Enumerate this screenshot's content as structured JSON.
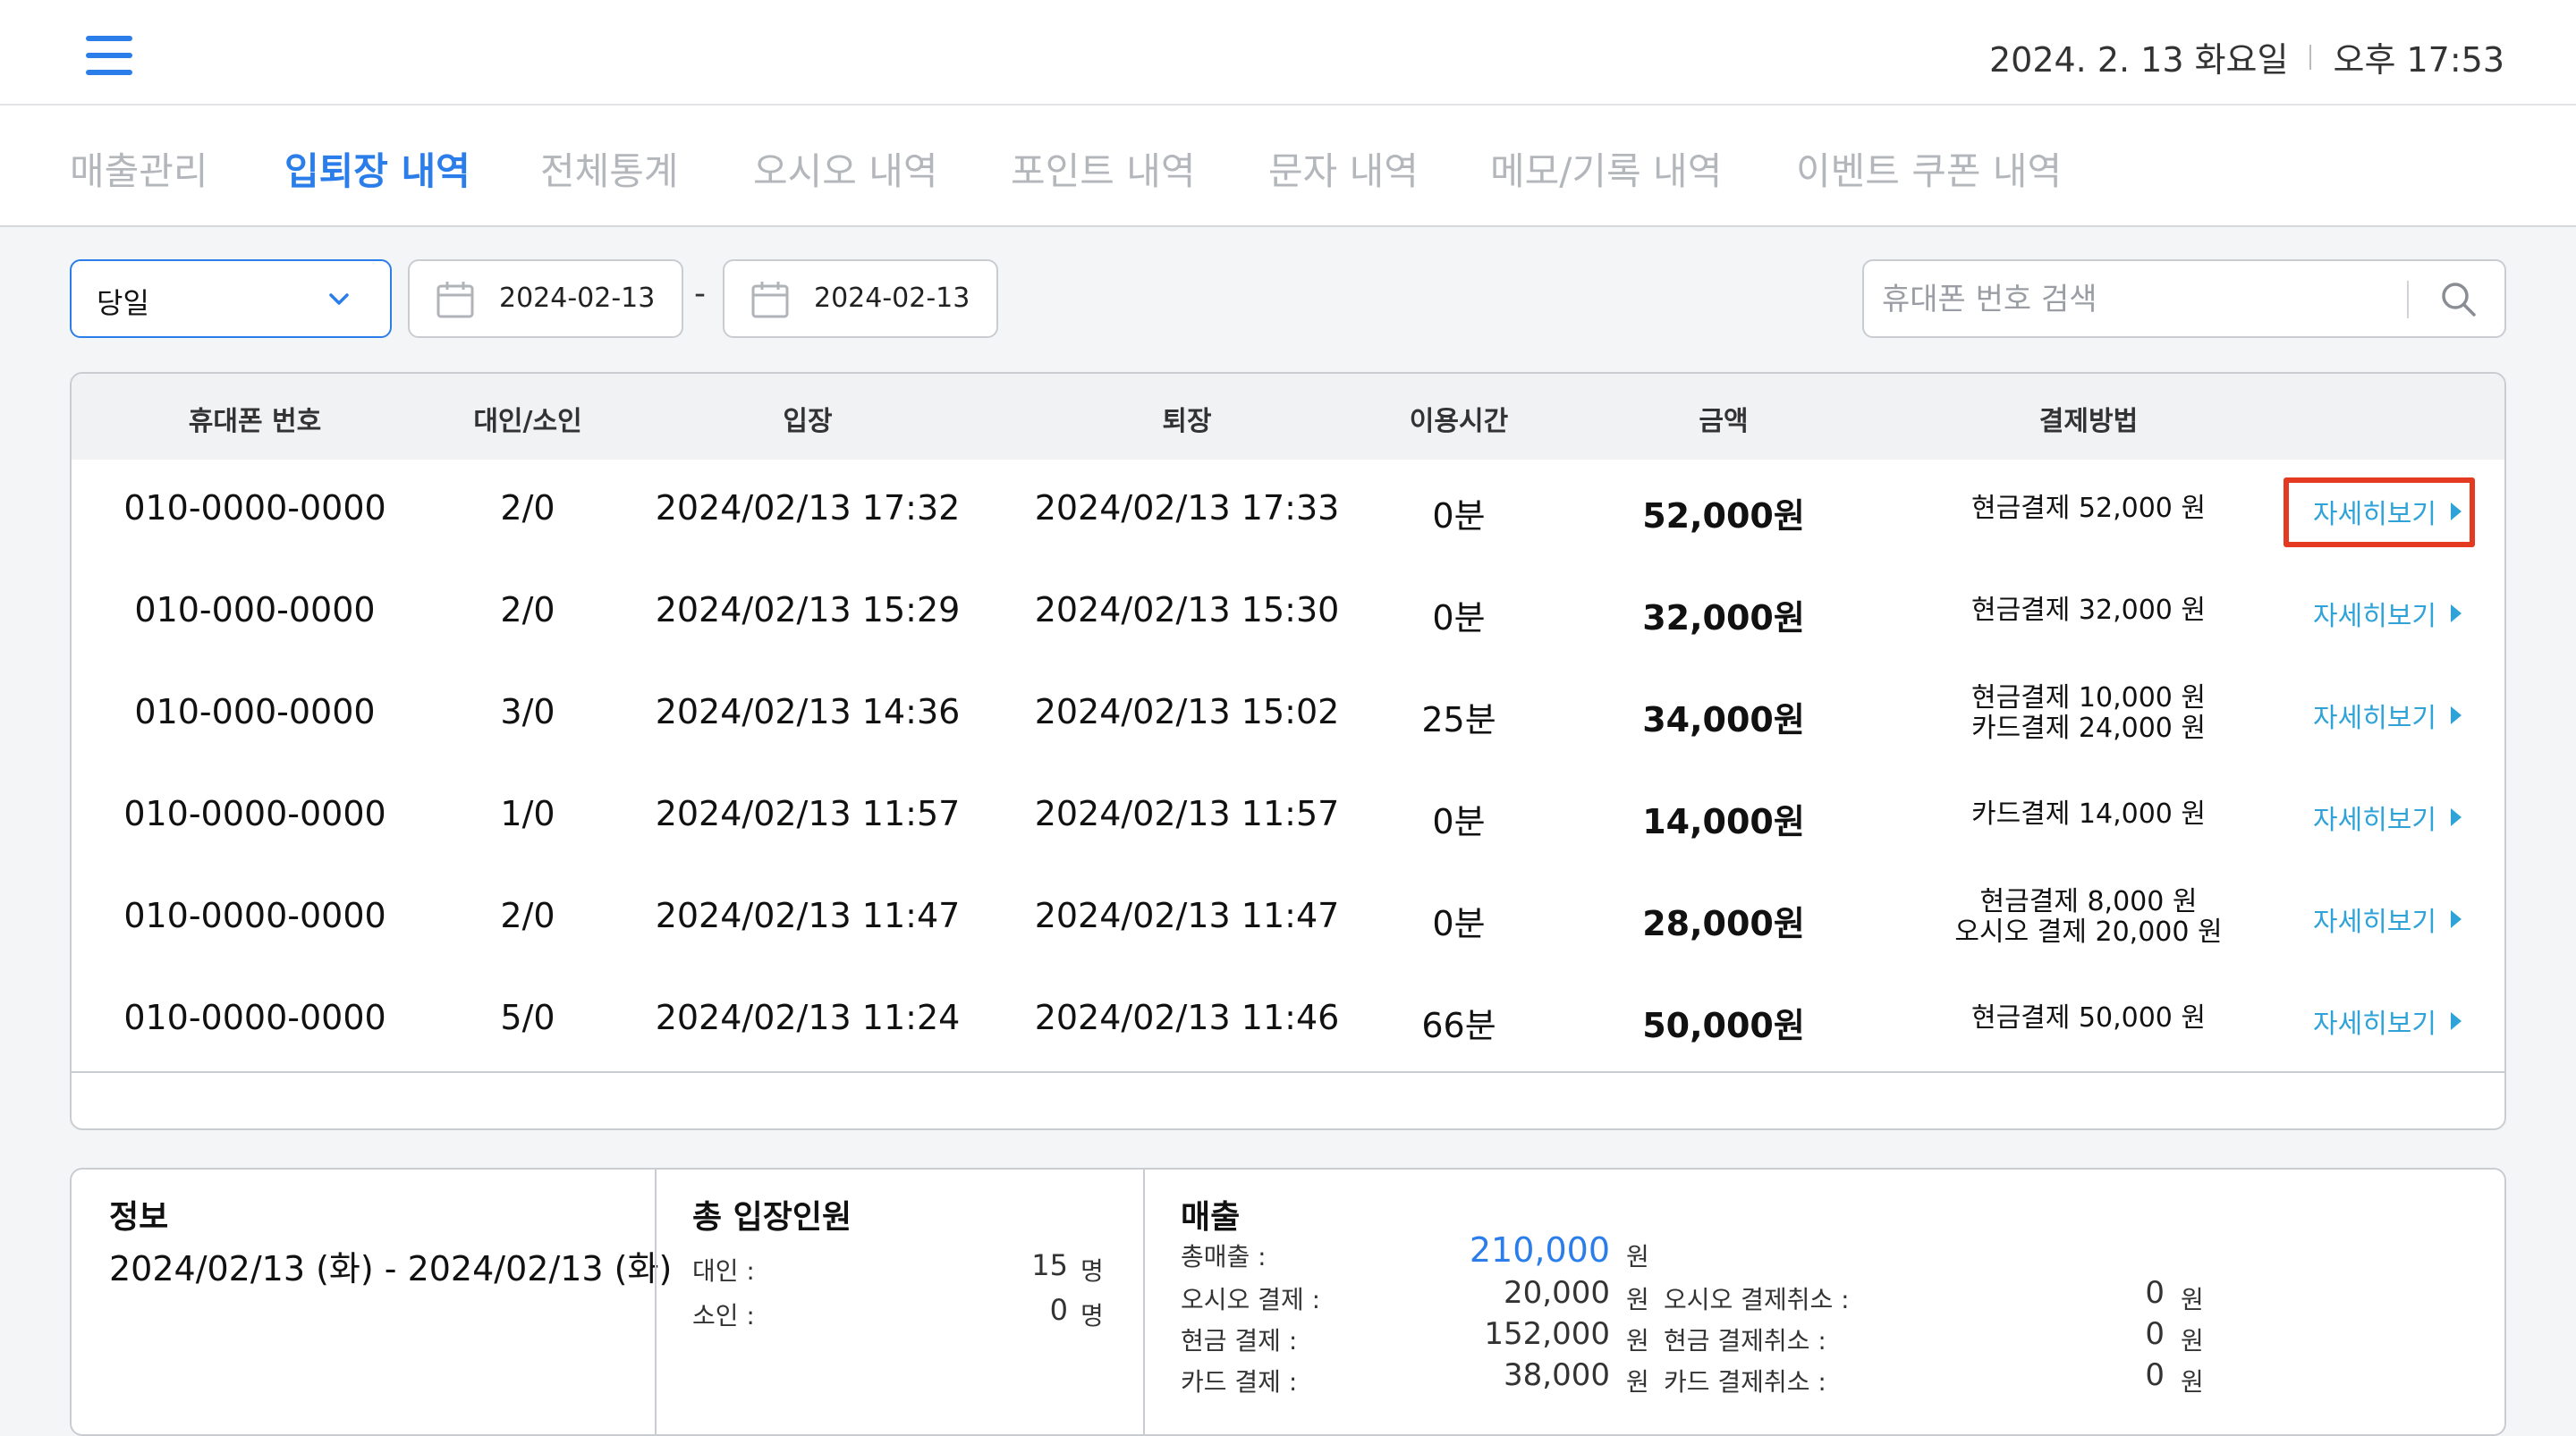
{
  "header": {
    "date": "2024. 2. 13 화요일",
    "time": "오후 17:53"
  },
  "tabs": [
    {
      "label": "매출관리",
      "active": false
    },
    {
      "label": "입퇴장 내역",
      "active": true
    },
    {
      "label": "전체통계",
      "active": false
    },
    {
      "label": "오시오 내역",
      "active": false
    },
    {
      "label": "포인트 내역",
      "active": false
    },
    {
      "label": "문자 내역",
      "active": false
    },
    {
      "label": "메모/기록 내역",
      "active": false
    },
    {
      "label": "이벤트 쿠폰 내역",
      "active": false
    }
  ],
  "filters": {
    "period": "당일",
    "start_date": "2024-02-13",
    "date_separator": "-",
    "end_date": "2024-02-13",
    "search_placeholder": "휴대폰 번호 검색"
  },
  "table": {
    "columns": [
      "휴대폰 번호",
      "대인/소인",
      "입장",
      "퇴장",
      "이용시간",
      "금액",
      "결제방법"
    ],
    "detail_label": "자세히보기",
    "rows": [
      {
        "phone": "010-0000-0000",
        "people": "2/0",
        "entry": "2024/02/13 17:32",
        "exit": "2024/02/13 17:33",
        "duration": "0분",
        "amount": "52,000원",
        "payment": [
          "현금결제 52,000 원"
        ]
      },
      {
        "phone": "010-000-0000",
        "people": "2/0",
        "entry": "2024/02/13 15:29",
        "exit": "2024/02/13 15:30",
        "duration": "0분",
        "amount": "32,000원",
        "payment": [
          "현금결제 32,000 원"
        ]
      },
      {
        "phone": "010-000-0000",
        "people": "3/0",
        "entry": "2024/02/13 14:36",
        "exit": "2024/02/13 15:02",
        "duration": "25분",
        "amount": "34,000원",
        "payment": [
          "현금결제 10,000 원",
          "카드결제 24,000 원"
        ]
      },
      {
        "phone": "010-0000-0000",
        "people": "1/0",
        "entry": "2024/02/13 11:57",
        "exit": "2024/02/13 11:57",
        "duration": "0분",
        "amount": "14,000원",
        "payment": [
          "카드결제 14,000 원"
        ]
      },
      {
        "phone": "010-0000-0000",
        "people": "2/0",
        "entry": "2024/02/13 11:47",
        "exit": "2024/02/13 11:47",
        "duration": "0분",
        "amount": "28,000원",
        "payment": [
          "현금결제 8,000 원",
          "오시오 결제 20,000 원"
        ]
      },
      {
        "phone": "010-0000-0000",
        "people": "5/0",
        "entry": "2024/02/13 11:24",
        "exit": "2024/02/13 11:46",
        "duration": "66분",
        "amount": "50,000원",
        "payment": [
          "현금결제 50,000 원"
        ]
      }
    ]
  },
  "summary": {
    "info_title": "정보",
    "info_range": "2024/02/13 (화)  -  2024/02/13 (화)",
    "visitors_title": "총 입장인원",
    "adult_label": "대인 :",
    "adult_count": "15",
    "child_label": "소인 :",
    "child_count": "0",
    "person_unit": "명",
    "sales_title": "매출",
    "won_unit": "원",
    "total_label": "총매출 :",
    "total_value": "210,000",
    "osio_label": "오시오 결제 :",
    "osio_value": "20,000",
    "osio_cancel_label": "오시오 결제취소 :",
    "osio_cancel_value": "0",
    "cash_label": "현금 결제 :",
    "cash_value": "152,000",
    "cash_cancel_label": "현금 결제취소 :",
    "cash_cancel_value": "0",
    "card_label": "카드 결제 :",
    "card_value": "38,000",
    "card_cancel_label": "카드 결제취소 :",
    "card_cancel_value": "0"
  },
  "colors": {
    "accent": "#2b7de9",
    "detail_link": "#2fa3d8",
    "highlight": "#e53a22"
  }
}
